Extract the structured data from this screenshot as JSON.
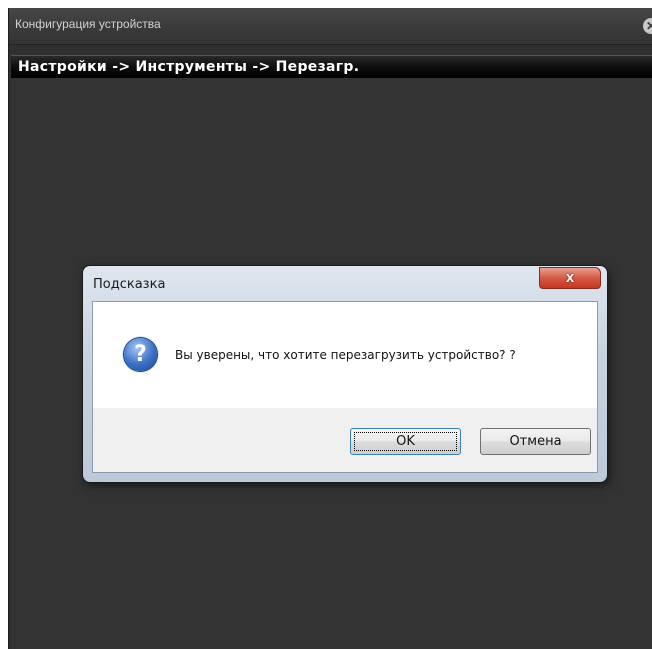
{
  "window": {
    "title": "Конфигурация устройства",
    "close_icon": "close-icon"
  },
  "breadcrumb": "Настройки -> Инструменты -> Перезагр.",
  "dialog": {
    "title": "Подсказка",
    "close_label": "x",
    "icon": "question-icon",
    "icon_glyph": "?",
    "message": "Вы уверены, что хотите перезагрузить устройство? ?",
    "ok_label": "OK",
    "cancel_label": "Отмена"
  },
  "colors": {
    "window_bg": "#303030",
    "breadcrumb_bg": "#000000",
    "close_button": "#c4371f"
  }
}
